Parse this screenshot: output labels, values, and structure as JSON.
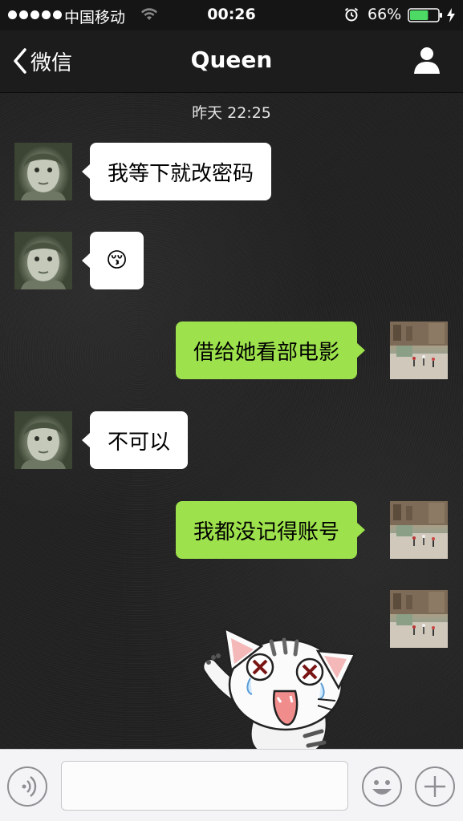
{
  "status_bar": {
    "carrier": "中国移动",
    "time": "00:26",
    "battery_percent": "66%",
    "battery_level": 0.66,
    "icons": [
      "signal-dots",
      "wifi-icon",
      "alarm-icon",
      "battery-icon",
      "charging-icon"
    ]
  },
  "nav": {
    "back_label": "微信",
    "title": "Queen",
    "icons": [
      "chevron-left-icon",
      "person-icon"
    ]
  },
  "chat": {
    "timestamp": "昨天 22:25",
    "messages": [
      {
        "side": "in",
        "text": "我等下就改密码"
      },
      {
        "side": "in",
        "text": "😚"
      },
      {
        "side": "out",
        "text": "借给她看部电影"
      },
      {
        "side": "in",
        "text": "不可以"
      },
      {
        "side": "out",
        "text": "我都没记得账号"
      },
      {
        "side": "out",
        "type": "sticker",
        "sticker": "crying-cartoon-cat"
      }
    ]
  },
  "input_bar": {
    "value": "",
    "icons": [
      "voice-icon",
      "emoji-icon",
      "plus-icon"
    ]
  },
  "colors": {
    "outgoing_bubble": "#9de24c",
    "incoming_bubble": "#ffffff",
    "battery_green": "#4cd964"
  }
}
